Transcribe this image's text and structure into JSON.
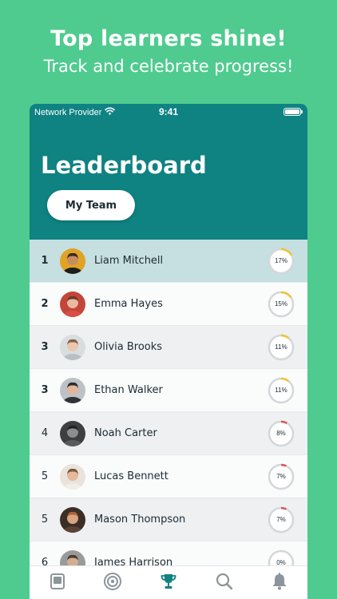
{
  "promo": {
    "title": "Top learners shine!",
    "subtitle": "Track and celebrate progress!"
  },
  "status_bar": {
    "carrier": "Network Provider",
    "time": "9:41"
  },
  "header": {
    "title": "Leaderboard",
    "team_button": "My Team"
  },
  "colors": {
    "background": "#4fcb8f",
    "header": "#0f8282",
    "highlight_row": "#c6dfe0",
    "progress_yellow": "#f2c230",
    "progress_red": "#e2524f",
    "tab_active": "#0f8282",
    "tab_inactive": "#8c959b"
  },
  "leaderboard": [
    {
      "rank": "1",
      "name": "Liam Mitchell",
      "progress": "17%",
      "progress_value": 0.17,
      "progress_color": "yellow",
      "highlight": true,
      "avatar": "avatar-yellow"
    },
    {
      "rank": "2",
      "name": "Emma Hayes",
      "progress": "15%",
      "progress_value": 0.15,
      "progress_color": "yellow",
      "highlight": false,
      "avatar": "avatar-red"
    },
    {
      "rank": "3",
      "name": "Olivia Brooks",
      "progress": "11%",
      "progress_value": 0.11,
      "progress_color": "yellow",
      "highlight": false,
      "avatar": "avatar-light"
    },
    {
      "rank": "3",
      "name": "Ethan Walker",
      "progress": "11%",
      "progress_value": 0.11,
      "progress_color": "yellow",
      "highlight": false,
      "avatar": "avatar-grey"
    },
    {
      "rank": "4",
      "name": "Noah Carter",
      "progress": "8%",
      "progress_value": 0.08,
      "progress_color": "red",
      "highlight": false,
      "avatar": "avatar-dark"
    },
    {
      "rank": "5",
      "name": "Lucas Bennett",
      "progress": "7%",
      "progress_value": 0.07,
      "progress_color": "red",
      "highlight": false,
      "avatar": "avatar-beige"
    },
    {
      "rank": "5",
      "name": "Mason Thompson",
      "progress": "7%",
      "progress_value": 0.07,
      "progress_color": "red",
      "highlight": false,
      "avatar": "avatar-brown"
    },
    {
      "rank": "6",
      "name": "James Harrison",
      "progress": "0%",
      "progress_value": 0.0,
      "progress_color": "red",
      "highlight": false,
      "avatar": "avatar-stone"
    }
  ],
  "tabs": [
    {
      "icon": "book-icon",
      "active": false
    },
    {
      "icon": "target-icon",
      "active": false
    },
    {
      "icon": "trophy-icon",
      "active": true
    },
    {
      "icon": "search-icon",
      "active": false
    },
    {
      "icon": "bell-icon",
      "active": false
    }
  ]
}
